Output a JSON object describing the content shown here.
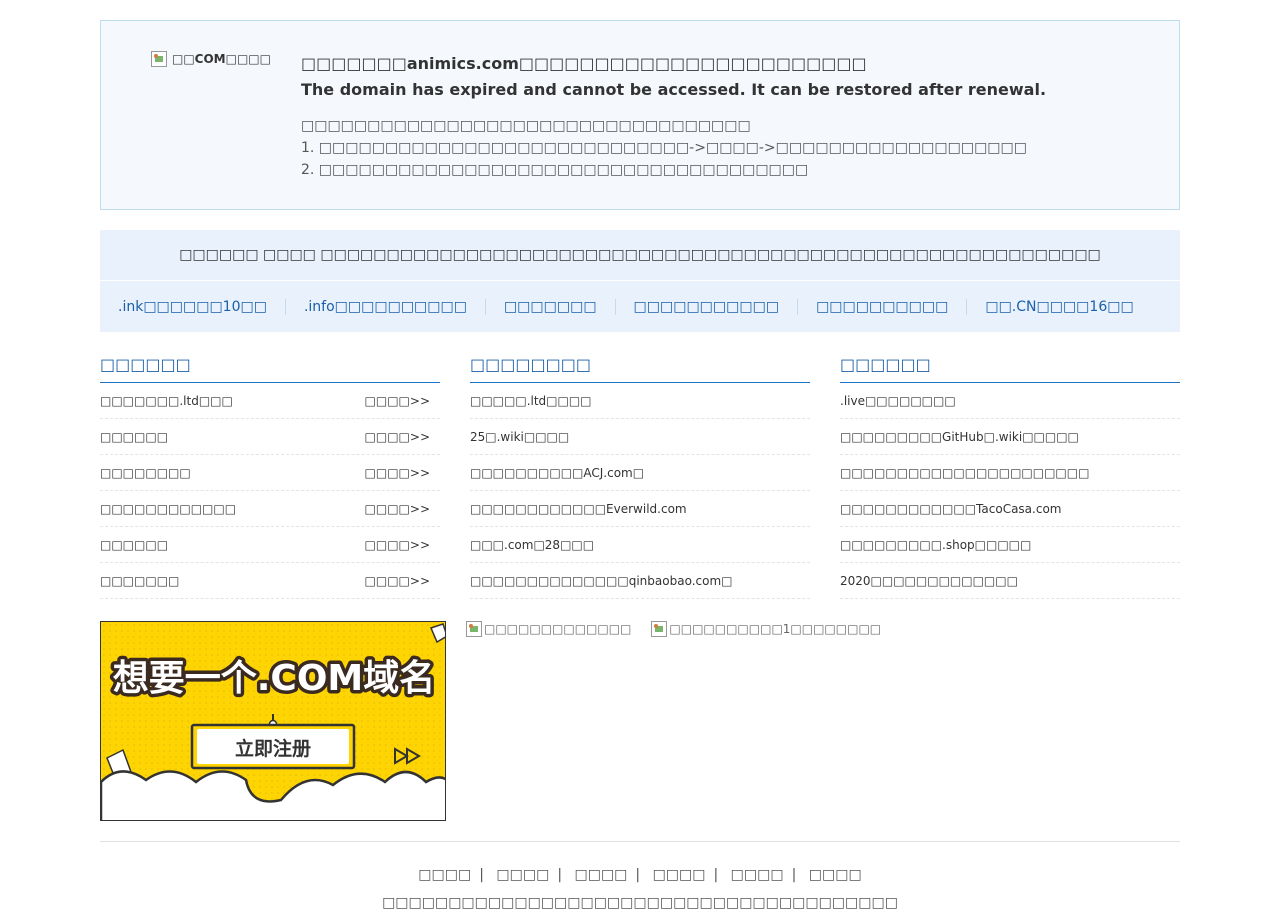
{
  "notice": {
    "logo_alt": "□□COM□□□□",
    "title": "□□□□□□□animics.com□□□□□□□□□□□□□□□□□□□□□□□",
    "title_en": "The domain has expired and cannot be accessed. It can be restored after renewal.",
    "lines": [
      "□□□□□□□□□□□□□□□□□□□□□□□□□□□□□□□□□□",
      "1. □□□□□□□□□□□□□□□□□□□□□□□□□□□□->□□□□->□□□□□□□□□□□□□□□□□□□",
      "2. □□□□□□□□□□□□□□□□□□□□□□□□□□□□□□□□□□□□□"
    ]
  },
  "band": {
    "text": "□□□□□□ □□□□ □□□□□□□□□□□□□□□□□□□□□□□□□□□□□□□□□□□□□□□□□□□□□□□□□□□□□□□□□□□",
    "links": [
      ".ink□□□□□□10□□",
      ".info□□□□□□□□□□",
      "□□□□□□□",
      "□□□□□□□□□□□",
      "□□□□□□□□□□",
      "□□.CN□□□□16□□"
    ]
  },
  "columns": [
    {
      "title": "□□□□□□",
      "rows": [
        {
          "text": "□□□□□□□.ltd□□□",
          "more": "□□□□>>"
        },
        {
          "text": "□□□□□□",
          "more": "□□□□>>"
        },
        {
          "text": "□□□□□□□□",
          "more": "□□□□>>"
        },
        {
          "text": "□□□□□□□□□□□□",
          "more": "□□□□>>"
        },
        {
          "text": "□□□□□□",
          "more": "□□□□>>"
        },
        {
          "text": "□□□□□□□",
          "more": "□□□□>>"
        }
      ]
    },
    {
      "title": "□□□□□□□□",
      "rows": [
        {
          "text": "□□□□□.ltd□□□□",
          "more": ""
        },
        {
          "text": "25□.wiki□□□□",
          "more": ""
        },
        {
          "text": "□□□□□□□□□□ACJ.com□",
          "more": ""
        },
        {
          "text": "□□□□□□□□□□□□Everwild.com",
          "more": ""
        },
        {
          "text": "□□□.com□28□□□",
          "more": ""
        },
        {
          "text": "□□□□□□□□□□□□□□qinbaobao.com□",
          "more": ""
        }
      ]
    },
    {
      "title": "□□□□□□",
      "rows": [
        {
          "text": ".live□□□□□□□□",
          "more": ""
        },
        {
          "text": "□□□□□□□□□GitHub□.wiki□□□□□",
          "more": ""
        },
        {
          "text": "□□□□□□□□□□□□□□□□□□□□□□",
          "more": ""
        },
        {
          "text": "□□□□□□□□□□□□TacoCasa.com",
          "more": ""
        },
        {
          "text": "□□□□□□□□□.shop□□□□□",
          "more": ""
        },
        {
          "text": "2020□□□□□□□□□□□□□",
          "more": ""
        }
      ]
    }
  ],
  "banner": {
    "headline": "想要一个.COM域名",
    "button": "立即注册"
  },
  "banner_alts": [
    "□□□□□□□□□□□□□",
    "□□□□□□□□□□1□□□□□□□□"
  ],
  "footer": {
    "links": [
      "□□□□",
      "□□□□",
      "□□□□",
      "□□□□",
      "□□□□",
      "□□□□"
    ],
    "copyright": "□□□□□□□□□□□□□□□□□□□□□□□□□□□□□□□□□□□□□□□"
  },
  "colors": {
    "accent": "#1a5fa8",
    "notice_bg": "#f5f9fd",
    "band_bg": "#e8f1fc",
    "banner_yellow": "#fed402"
  }
}
